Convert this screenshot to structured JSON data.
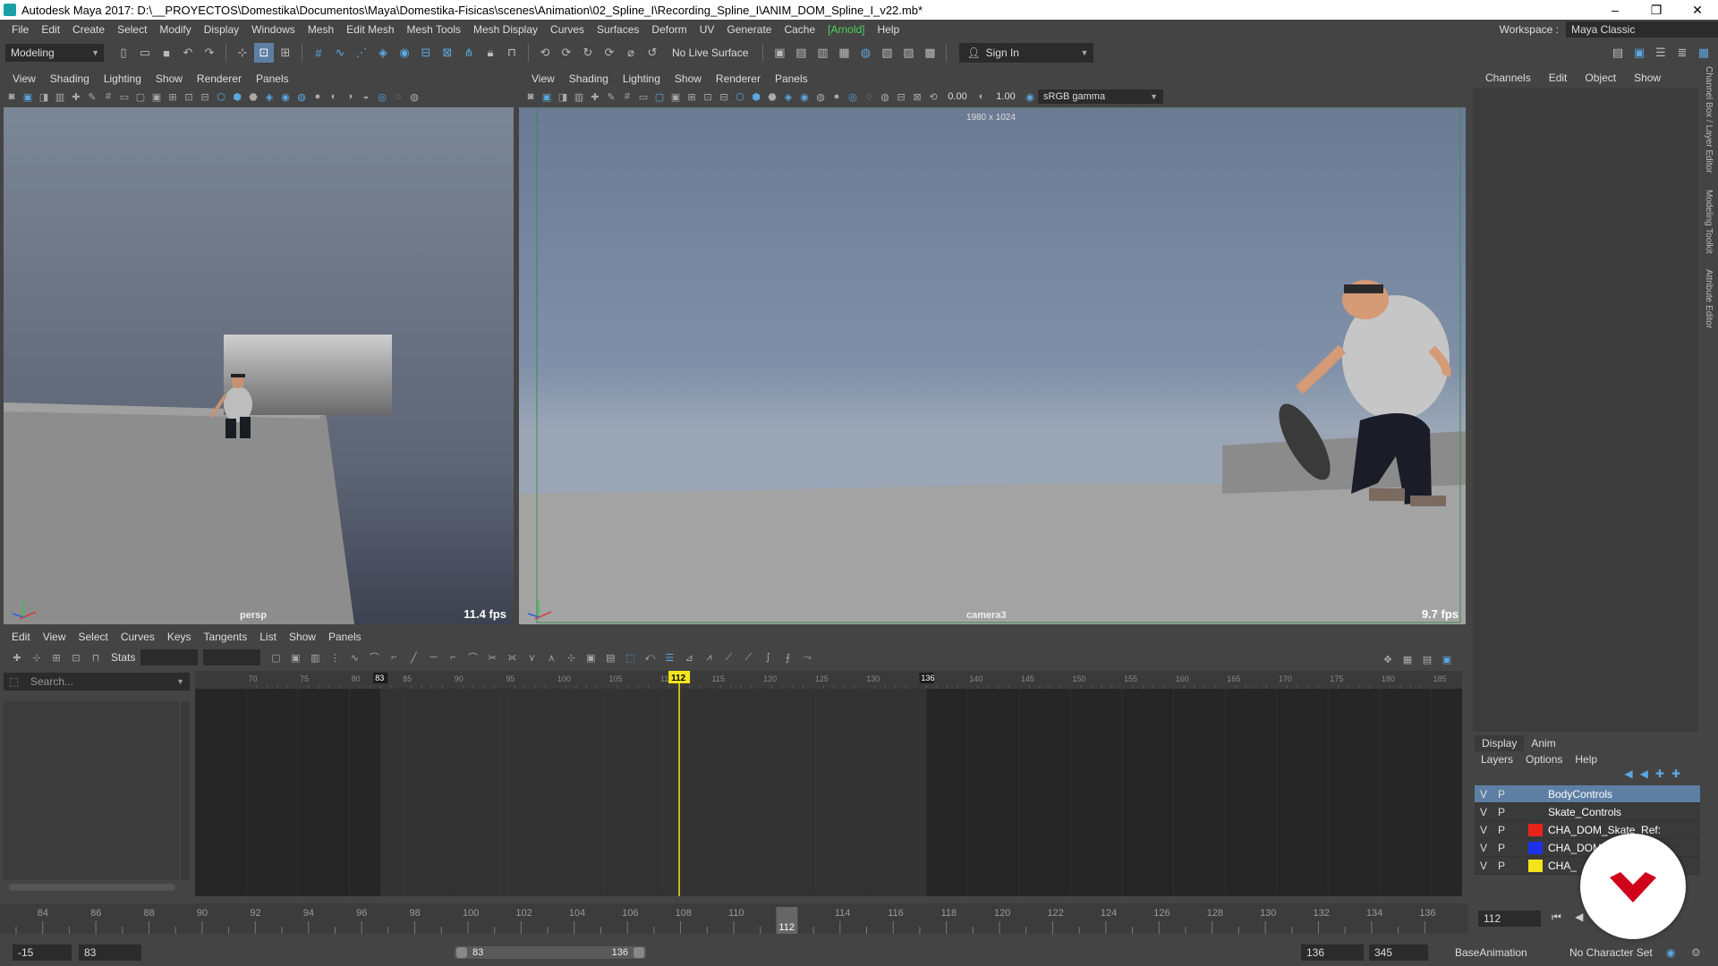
{
  "window": {
    "title": "Autodesk Maya 2017: D:\\__PROYECTOS\\Domestika\\Documentos\\Maya\\Domestika-Fisicas\\scenes\\Animation\\02_Spline_I\\Recording_Spline_I\\ANIM_DOM_Spline_I_v22.mb*",
    "minimize": "–",
    "maximize": "❐",
    "close": "✕"
  },
  "menubar": {
    "items": [
      "File",
      "Edit",
      "Create",
      "Select",
      "Modify",
      "Display",
      "Windows",
      "Mesh",
      "Edit Mesh",
      "Mesh Tools",
      "Mesh Display",
      "Curves",
      "Surfaces",
      "Deform",
      "UV",
      "Generate",
      "Cache",
      "[Arnold]",
      "Help"
    ],
    "workspace_label": "Workspace :",
    "workspace_value": "Maya Classic"
  },
  "statusline": {
    "mode": "Modeling",
    "live_surface": "No Live Surface",
    "sign_in": "Sign In"
  },
  "left_viewport": {
    "menu": [
      "View",
      "Shading",
      "Lighting",
      "Show",
      "Renderer",
      "Panels"
    ],
    "camera": "persp",
    "fps": "11.4 fps"
  },
  "right_viewport": {
    "menu": [
      "View",
      "Shading",
      "Lighting",
      "Show",
      "Renderer",
      "Panels"
    ],
    "camera": "camera3",
    "fps": "9.7 fps",
    "resolution": "1980 x 1024",
    "exposure": "0.00",
    "gamma": "1.00",
    "color_space": "sRGB gamma"
  },
  "channel_box": {
    "menu": [
      "Channels",
      "Edit",
      "Object",
      "Show"
    ],
    "side_tabs": [
      "Channel Box / Layer Editor",
      "Modeling Toolkit",
      "Attribute Editor"
    ]
  },
  "layer_editor": {
    "tabs": [
      "Display",
      "Anim"
    ],
    "menu": [
      "Layers",
      "Options",
      "Help"
    ],
    "layers": [
      {
        "v": "V",
        "p": "P",
        "name": "BodyControls",
        "color": "",
        "selected": true
      },
      {
        "v": "V",
        "p": "P",
        "name": "Skate_Controls",
        "color": "",
        "selected": false
      },
      {
        "v": "V",
        "p": "P",
        "name": "CHA_DOM_Skate_Ref:",
        "color": "#e8231c",
        "selected": false
      },
      {
        "v": "V",
        "p": "P",
        "name": "CHA_DOM_Ref:",
        "color": "#1c32e8",
        "selected": false
      },
      {
        "v": "V",
        "p": "P",
        "name": "CHA_",
        "color": "#f2e41a",
        "selected": false
      }
    ]
  },
  "graph_editor": {
    "menu": [
      "Edit",
      "View",
      "Select",
      "Curves",
      "Keys",
      "Tangents",
      "List",
      "Show",
      "Panels"
    ],
    "stats_label": "Stats",
    "search_placeholder": "Search...",
    "ruler_ticks": [
      70,
      75,
      80,
      85,
      90,
      95,
      100,
      105,
      110,
      115,
      120,
      125,
      130,
      135,
      140,
      145,
      150,
      155,
      160,
      165,
      170,
      175,
      180,
      185
    ],
    "range_start": "83",
    "range_end": "136",
    "current_frame": "112"
  },
  "time_slider": {
    "ticks": [
      84,
      86,
      88,
      90,
      92,
      94,
      96,
      98,
      100,
      102,
      104,
      106,
      108,
      110,
      112,
      114,
      116,
      118,
      120,
      122,
      124,
      126,
      128,
      130,
      132,
      134,
      136
    ],
    "current_frame": "112",
    "current_frame_field": "112",
    "playback_buttons": "⏮ ◀ ▶ ⏭"
  },
  "range_slider": {
    "anim_start": "-15",
    "playback_start": "83",
    "range_inner_start": "83",
    "range_inner_end": "136",
    "playback_end": "136",
    "anim_end": "345",
    "anim_layer": "BaseAnimation",
    "character_set": "No Character Set"
  },
  "colors": {
    "accent": "#5d7fa4",
    "playhead": "#f2e41a",
    "arnold": "#4cd15a",
    "badge": "#d0021b"
  }
}
